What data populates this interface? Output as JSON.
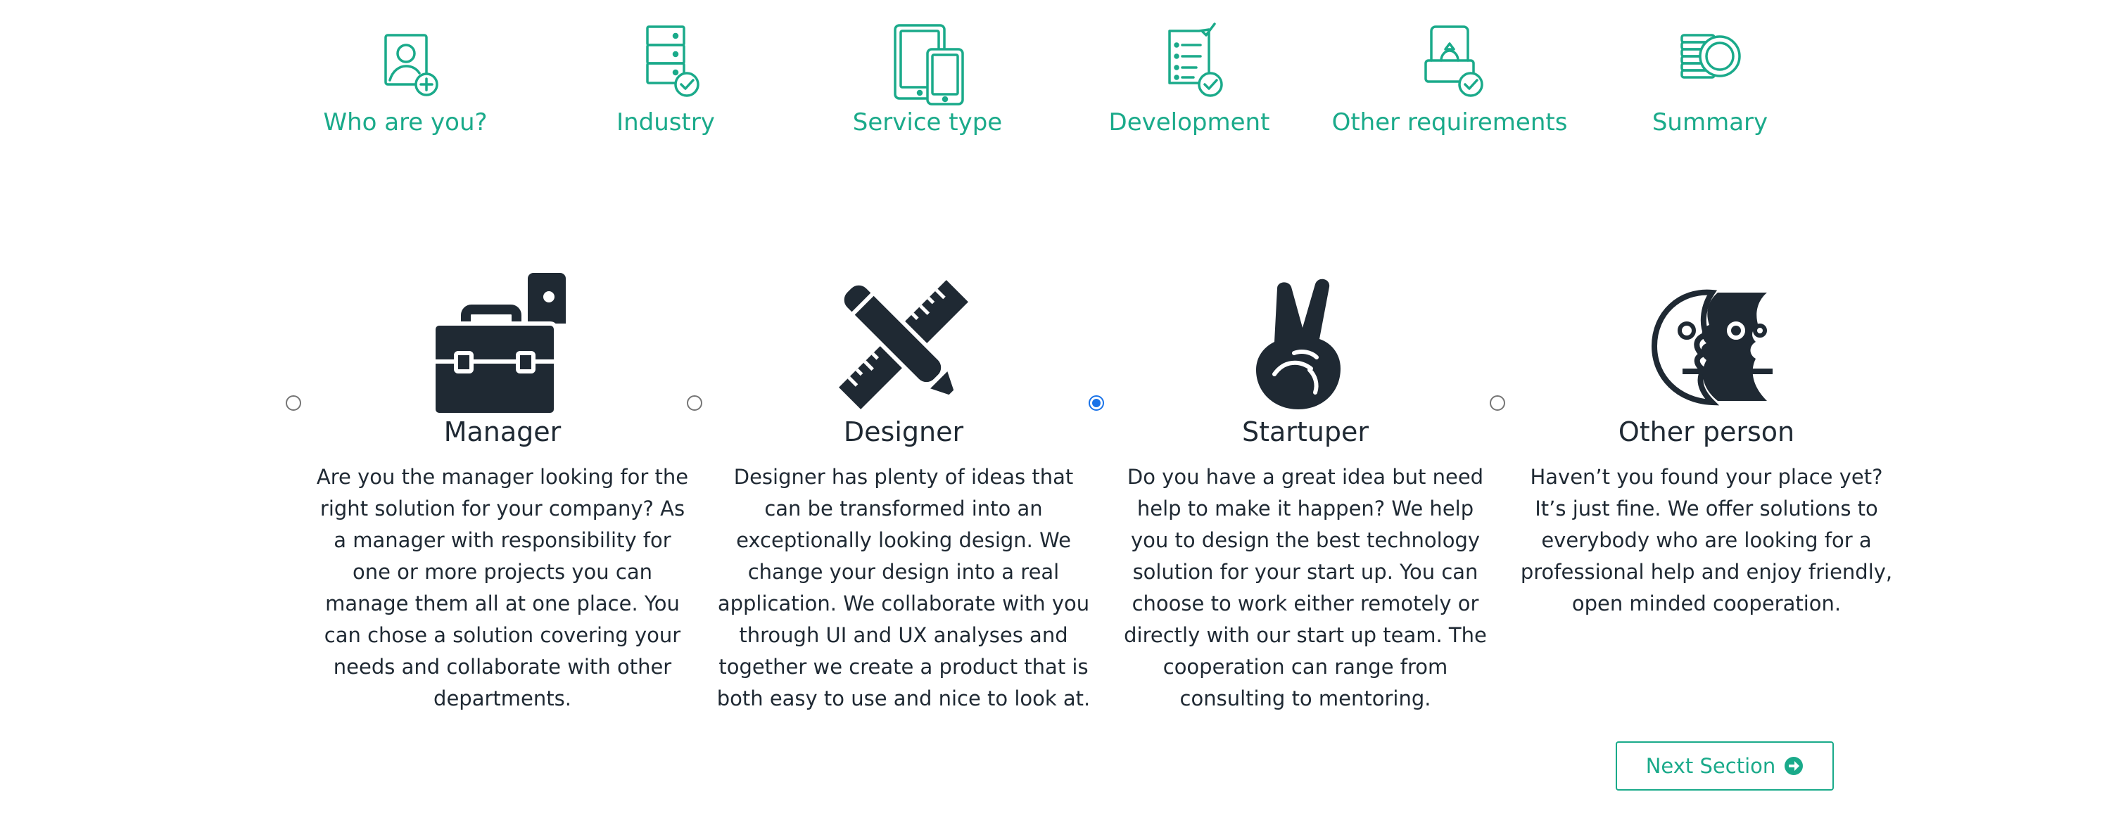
{
  "colors": {
    "accent": "#1aaa8a",
    "text": "#1f2933",
    "icon_dark": "#1f2933",
    "radio_checked": "#1a73e8"
  },
  "steps": [
    {
      "label": "Who are you?",
      "icon": "user-add-icon"
    },
    {
      "label": "Industry",
      "icon": "server-check-icon"
    },
    {
      "label": "Service type",
      "icon": "devices-icon"
    },
    {
      "label": "Development",
      "icon": "checklist-icon"
    },
    {
      "label": "Other requirements",
      "icon": "ring-box-check-icon"
    },
    {
      "label": "Summary",
      "icon": "coins-icon"
    }
  ],
  "options": [
    {
      "title": "Manager",
      "icon": "briefcase-icon",
      "selected": false,
      "description": "Are you the manager looking for the right solution for your company? As a manager with responsibility for one or more projects you can manage them all at one place. You can chose a solution covering your needs and collaborate with other departments."
    },
    {
      "title": "Designer",
      "icon": "pencil-ruler-icon",
      "selected": false,
      "description": "Designer has plenty of ideas that can be transformed into an exceptionally looking design. We change your design into a real application. We collaborate with you through UI and UX analyses and together we create a product that is both easy to use and nice to look at."
    },
    {
      "title": "Startuper",
      "icon": "peace-hand-icon",
      "selected": true,
      "description": "Do you have a great idea but need help to make it happen? We help you to design the best technology solution for your start up. You can choose to work either remotely or directly with our start up team. The cooperation can range from consulting to mentoring."
    },
    {
      "title": "Other person",
      "icon": "two-faces-icon",
      "selected": false,
      "description": "Haven’t you found your place yet? It’s just fine. We offer solutions to everybody who are looking for a professional help and enjoy friendly, open minded cooperation."
    }
  ],
  "next_button": {
    "label": "Next Section",
    "icon": "arrow-circle-right-icon"
  }
}
